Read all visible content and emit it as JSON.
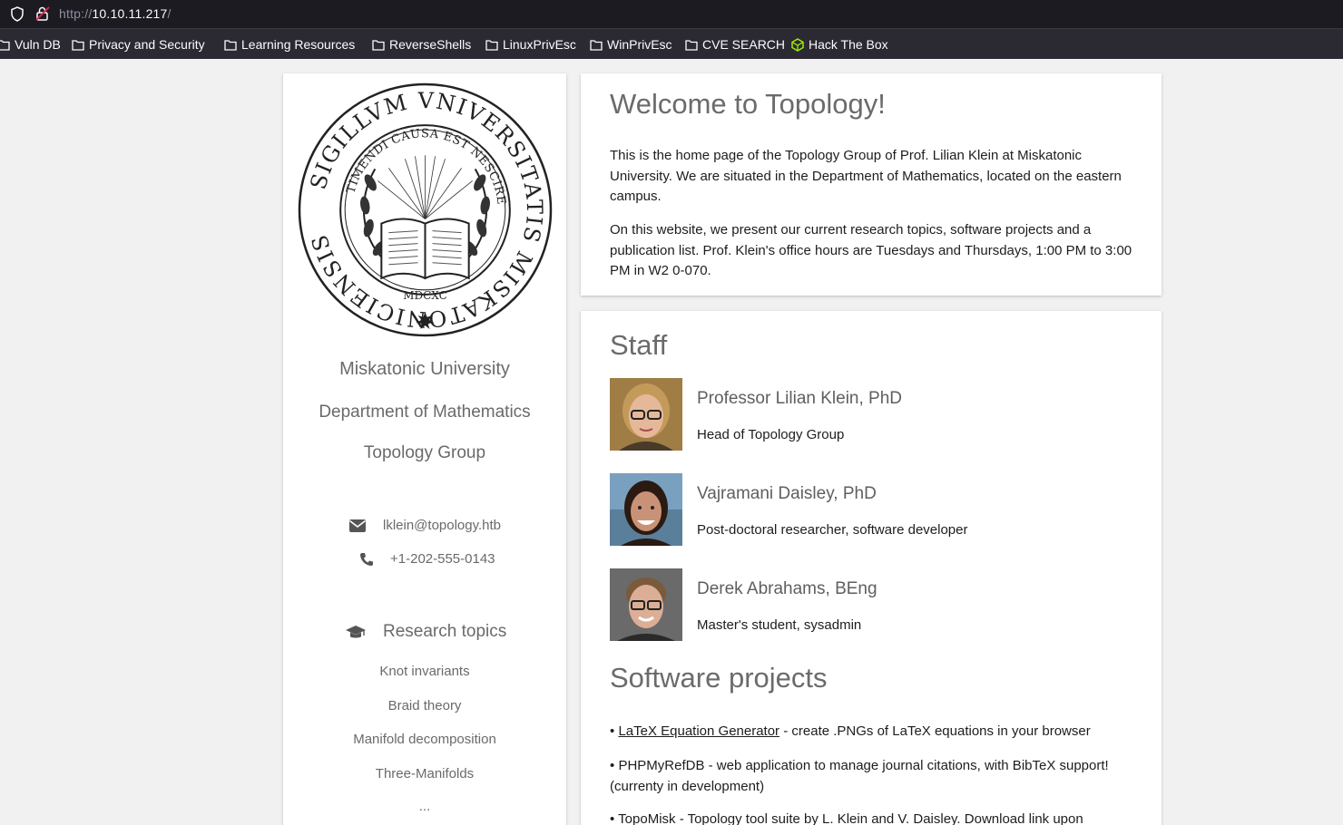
{
  "browser": {
    "url_scheme": "http://",
    "url_host": "10.10.11.217",
    "url_path": "/",
    "bookmarks": [
      {
        "label": "Vuln DB",
        "icon": "folder-icon"
      },
      {
        "label": "Privacy and Security",
        "icon": "folder-icon"
      },
      {
        "label": "Learning Resources",
        "icon": "folder-icon"
      },
      {
        "label": "ReverseShells",
        "icon": "folder-icon"
      },
      {
        "label": "LinuxPrivEsc",
        "icon": "folder-icon"
      },
      {
        "label": "WinPrivEsc",
        "icon": "folder-icon"
      },
      {
        "label": "CVE SEARCH",
        "icon": "folder-icon"
      },
      {
        "label": "Hack The Box",
        "icon": "htb-cube-icon"
      }
    ]
  },
  "sidebar": {
    "seal": {
      "outer_text": "SIGILLVM VNIVERSITATIS MISKATONICIENSIS",
      "inner_text": "TIMENDI CAUSA EST NESCIRE",
      "year": "MDCXC"
    },
    "university": "Miskatonic University",
    "department": "Department of Mathematics",
    "group": "Topology Group",
    "email": "lklein@topology.htb",
    "phone": "+1-202-555-0143",
    "research_heading": "Research topics",
    "topics": [
      "Knot invariants",
      "Braid theory",
      "Manifold decomposition",
      "Three-Manifolds",
      "..."
    ]
  },
  "welcome": {
    "title": "Welcome to Topology!",
    "p1": "This is the home page of the Topology Group of Prof. Lilian Klein at Miskatonic University. We are situated in the Department of Mathematics, located on the eastern campus.",
    "p2": "On this website, we present our current research topics, software projects and a publication list. Prof. Klein's office hours are Tuesdays and Thursdays, 1:00 PM to 3:00 PM in W2 0-070."
  },
  "staff": {
    "title": "Staff",
    "members": [
      {
        "name": "Professor Lilian Klein, PhD",
        "role": "Head of Topology Group"
      },
      {
        "name": "Vajramani Daisley, PhD",
        "role": "Post-doctoral researcher, software developer"
      },
      {
        "name": "Derek Abrahams, BEng",
        "role": "Master's student, sysadmin"
      }
    ]
  },
  "software": {
    "title": "Software projects",
    "items": [
      {
        "bullet": "•",
        "link": "LaTeX Equation Generator",
        "text": " - create .PNGs of LaTeX equations in your browser"
      },
      {
        "bullet": "•",
        "text": "PHPMyRefDB - web application to manage journal citations, with BibTeX support! (currenty in development)"
      },
      {
        "bullet": "•",
        "text": "TopoMisk - Topology tool suite by L. Klein and V. Daisley. Download link upon"
      }
    ]
  },
  "colors": {
    "background": "#f1f1f1",
    "heading_gray": "#6b6b6b",
    "text": "#1d1d1d",
    "chrome": "#1c1b22",
    "bookmark_bar": "#2b2a33"
  }
}
